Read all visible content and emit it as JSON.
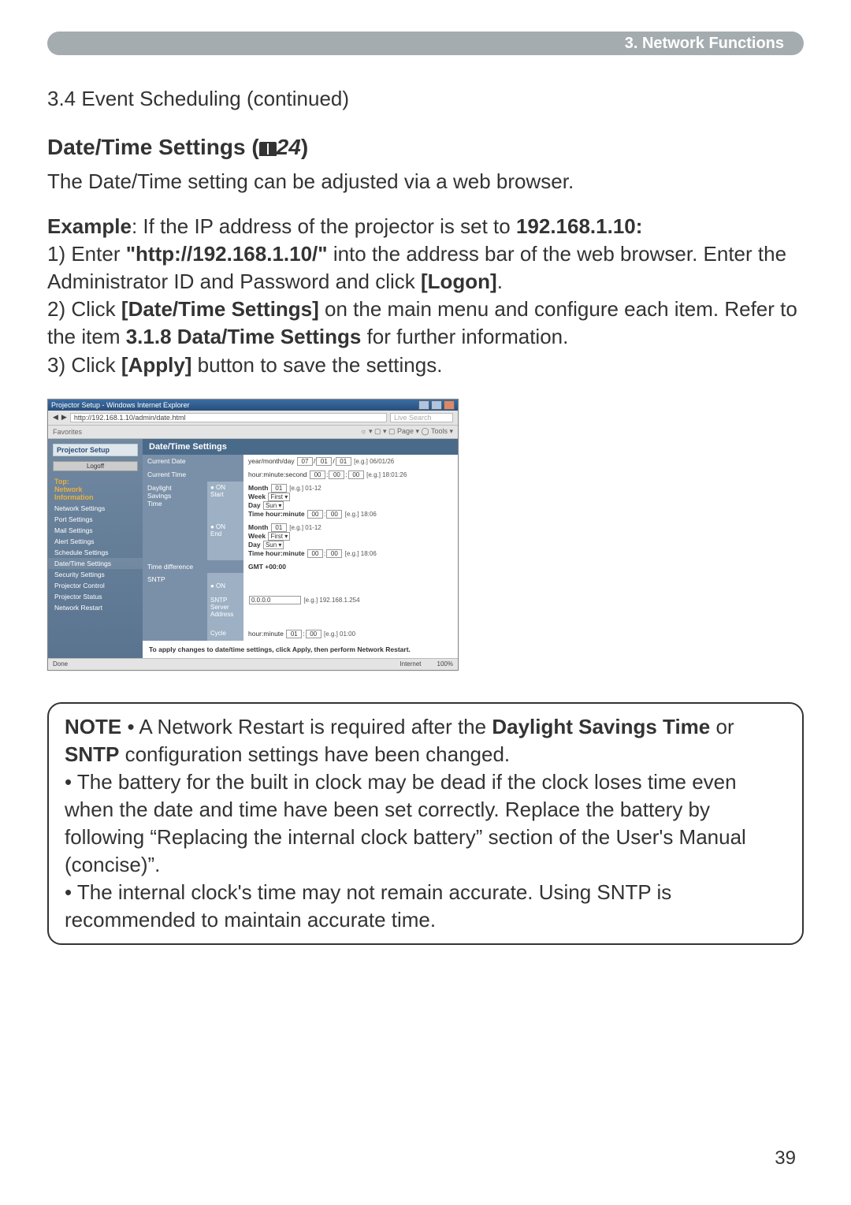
{
  "header": {
    "chapter": "3. Network Functions"
  },
  "section_continued": "3.4 Event Scheduling (continued)",
  "subsection": {
    "title_prefix": "Date/Time Settings (",
    "ref": "24",
    "title_suffix": ")"
  },
  "intro": "The Date/Time setting can be adjusted via a web browser.",
  "example": {
    "label": "Example",
    "line": ": If the IP address of the projector is set to ",
    "ip": "192.168.1.10:"
  },
  "steps": {
    "s1_a": "1) Enter ",
    "s1_url": "\"http://192.168.1.10/\"",
    "s1_b": " into the address bar of the web browser. Enter the Administrator ID and Password and click ",
    "s1_btn": "[Logon]",
    "s1_c": ".",
    "s2_a": "2) Click ",
    "s2_btn": "[Date/Time Settings]",
    "s2_b": " on the main menu and configure each item. Refer to the item ",
    "s2_ref": "3.1.8 Data/Time Settings",
    "s2_c": " for further information.",
    "s3_a": "3) Click ",
    "s3_btn": "[Apply]",
    "s3_b": " button to save the settings."
  },
  "screenshot": {
    "window_title": "Projector Setup - Windows Internet Explorer",
    "url": "http://192.168.1.10/admin/date.html",
    "searchhint": "Live Search",
    "fav": "Favorites",
    "toolsright": "☼ ▾ ▢  ▾  ▢ Page ▾ ◯ Tools ▾",
    "brand": "Projector Setup",
    "main_title": "Date/Time Settings",
    "logoff": "Logoff",
    "side": {
      "top": "Top:\nNetwork\nInformation",
      "items": [
        "Network Settings",
        "Port Settings",
        "Mail Settings",
        "Alert Settings",
        "Schedule Settings",
        "Date/Time Settings",
        "Security Settings",
        "Projector Control",
        "Projector Status",
        "Network Restart"
      ]
    },
    "rows": {
      "current_date": {
        "label": "Current Date",
        "hint": "year/month/day",
        "eg": "[e.g.] 06/01/26",
        "v1": "07",
        "v2": "01",
        "v3": "01"
      },
      "current_time": {
        "label": "Current Time",
        "hint": "hour:minute:second",
        "eg": "[e.g.] 18:01:26",
        "v1": "00",
        "v2": "00",
        "v3": "00"
      },
      "daylight": {
        "label": "Daylight\nSavings\nTime",
        "sub_on": "● ON",
        "sub_start": "Start",
        "sub_end": "End",
        "start": {
          "month_l": "Month",
          "month_eg": "[e.g.] 01-12",
          "week_l": "Week",
          "day_l": "Day",
          "time_l": "Time hour:minute",
          "time_eg": "[e.g.] 18:06"
        },
        "end": {
          "month_l": "Month",
          "month_eg": "[e.g.] 01-12",
          "week_l": "Week",
          "day_l": "Day",
          "time_l": "Time hour:minute",
          "time_eg": "[e.g.] 18:06"
        }
      },
      "timediff": {
        "label": "Time difference",
        "gmt": "GMT +00:00"
      },
      "sntp": {
        "label": "SNTP",
        "sub_on": "● ON",
        "addr_l": "SNTP Server\nAddress",
        "addr_v": "0.0.0.0",
        "addr_eg": "[e.g.] 192.168.1.254",
        "cycle_l": "Cycle",
        "cycle_hint": "hour:minute",
        "cycle_eg": "[e.g.] 01:00"
      }
    },
    "apply_text": "To apply changes to date/time settings, click Apply, then perform Network Restart.",
    "status_left": "Done",
    "status_right1": "Internet",
    "status_right2": "100%"
  },
  "note": {
    "label": "NOTE",
    "l1a": "  • A Network Restart is required after the ",
    "l1b": "Daylight Savings Time",
    "l1c": " or ",
    "l1d": "SNTP",
    "l1e": " configuration settings have been changed.",
    "l2": "• The battery for the built in clock may be dead if the clock loses time even when the date and time have been set correctly. Replace the battery by following “Replacing the internal clock battery” section of the User's Manual (concise)”.",
    "l3": "• The internal clock's time may not remain accurate. Using SNTP is recommended to maintain accurate time."
  },
  "page_number": "39"
}
